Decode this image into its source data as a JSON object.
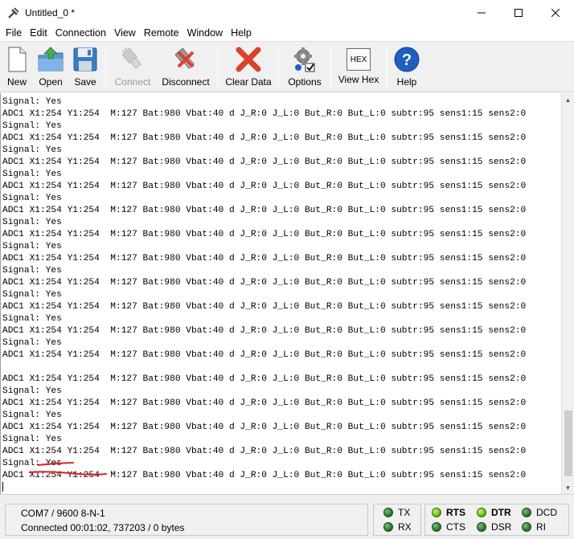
{
  "window": {
    "title": "Untitled_0 *",
    "controls": [
      "minimize",
      "maximize",
      "close"
    ]
  },
  "menu": [
    "File",
    "Edit",
    "Connection",
    "View",
    "Remote",
    "Window",
    "Help"
  ],
  "toolbar": {
    "new": "New",
    "open": "Open",
    "save": "Save",
    "connect": "Connect",
    "disconnect": "Disconnect",
    "clear_data": "Clear Data",
    "options": "Options",
    "view_hex": "View Hex",
    "view_hex_icon_text": "HEX",
    "help": "Help"
  },
  "terminal": {
    "lines": [
      "Signal: Yes",
      "ADC1 X1:254 Y1:254  M:127 Bat:980 Vbat:40 d J_R:0 J_L:0 But_R:0 But_L:0 subtr:95 sens1:15 sens2:0",
      "Signal: Yes",
      "ADC1 X1:254 Y1:254  M:127 Bat:980 Vbat:40 d J_R:0 J_L:0 But_R:0 But_L:0 subtr:95 sens1:15 sens2:0",
      "Signal: Yes",
      "ADC1 X1:254 Y1:254  M:127 Bat:980 Vbat:40 d J_R:0 J_L:0 But_R:0 But_L:0 subtr:95 sens1:15 sens2:0",
      "Signal: Yes",
      "ADC1 X1:254 Y1:254  M:127 Bat:980 Vbat:40 d J_R:0 J_L:0 But_R:0 But_L:0 subtr:95 sens1:15 sens2:0",
      "Signal: Yes",
      "ADC1 X1:254 Y1:254  M:127 Bat:980 Vbat:40 d J_R:0 J_L:0 But_R:0 But_L:0 subtr:95 sens1:15 sens2:0",
      "Signal: Yes",
      "ADC1 X1:254 Y1:254  M:127 Bat:980 Vbat:40 d J_R:0 J_L:0 But_R:0 But_L:0 subtr:95 sens1:15 sens2:0",
      "Signal: Yes",
      "ADC1 X1:254 Y1:254  M:127 Bat:980 Vbat:40 d J_R:0 J_L:0 But_R:0 But_L:0 subtr:95 sens1:15 sens2:0",
      "Signal: Yes",
      "ADC1 X1:254 Y1:254  M:127 Bat:980 Vbat:40 d J_R:0 J_L:0 But_R:0 But_L:0 subtr:95 sens1:15 sens2:0",
      "Signal: Yes",
      "ADC1 X1:254 Y1:254  M:127 Bat:980 Vbat:40 d J_R:0 J_L:0 But_R:0 But_L:0 subtr:95 sens1:15 sens2:0",
      "Signal: Yes",
      "ADC1 X1:254 Y1:254  M:127 Bat:980 Vbat:40 d J_R:0 J_L:0 But_R:0 But_L:0 subtr:95 sens1:15 sens2:0",
      "Signal: Yes",
      "ADC1 X1:254 Y1:254  M:127 Bat:980 Vbat:40 d J_R:0 J_L:0 But_R:0 But_L:0 subtr:95 sens1:15 sens2:0",
      "",
      "ADC1 X1:254 Y1:254  M:127 Bat:980 Vbat:40 d J_R:0 J_L:0 But_R:0 But_L:0 subtr:95 sens1:15 sens2:0",
      "Signal: Yes",
      "ADC1 X1:254 Y1:254  M:127 Bat:980 Vbat:40 d J_R:0 J_L:0 But_R:0 But_L:0 subtr:95 sens1:15 sens2:0",
      "Signal: Yes",
      "ADC1 X1:254 Y1:254  M:127 Bat:980 Vbat:40 d J_R:0 J_L:0 But_R:0 But_L:0 subtr:95 sens1:15 sens2:0",
      "Signal: Yes",
      "ADC1 X1:254 Y1:254  M:127 Bat:980 Vbat:40 d J_R:0 J_L:0 But_R:0 But_L:0 subtr:95 sens1:15 sens2:0",
      "Signal: Yes",
      "ADC1 X1:254 Y1:254  M:127 Bat:980 Vbat:40 d J_R:0 J_L:0 But_R:0 But_L:0 subtr:95 sens1:15 sens2:0"
    ],
    "underline_color": "#e02020"
  },
  "status": {
    "port": "COM7 / 9600 8-N-1",
    "connection": "Connected 00:01:02, 737203 / 0 bytes"
  },
  "leds": {
    "tx": "TX",
    "rx": "RX",
    "rts": "RTS",
    "cts": "CTS",
    "dtr": "DTR",
    "dsr": "DSR",
    "dcd": "DCD",
    "ri": "RI"
  },
  "colors": {
    "toolbar_bg": "#f0f0f0",
    "led_on": "#6fbf1a",
    "led_off": "#2e7d32",
    "clear_icon": "#d9432a",
    "help_icon": "#1f5fbf"
  }
}
